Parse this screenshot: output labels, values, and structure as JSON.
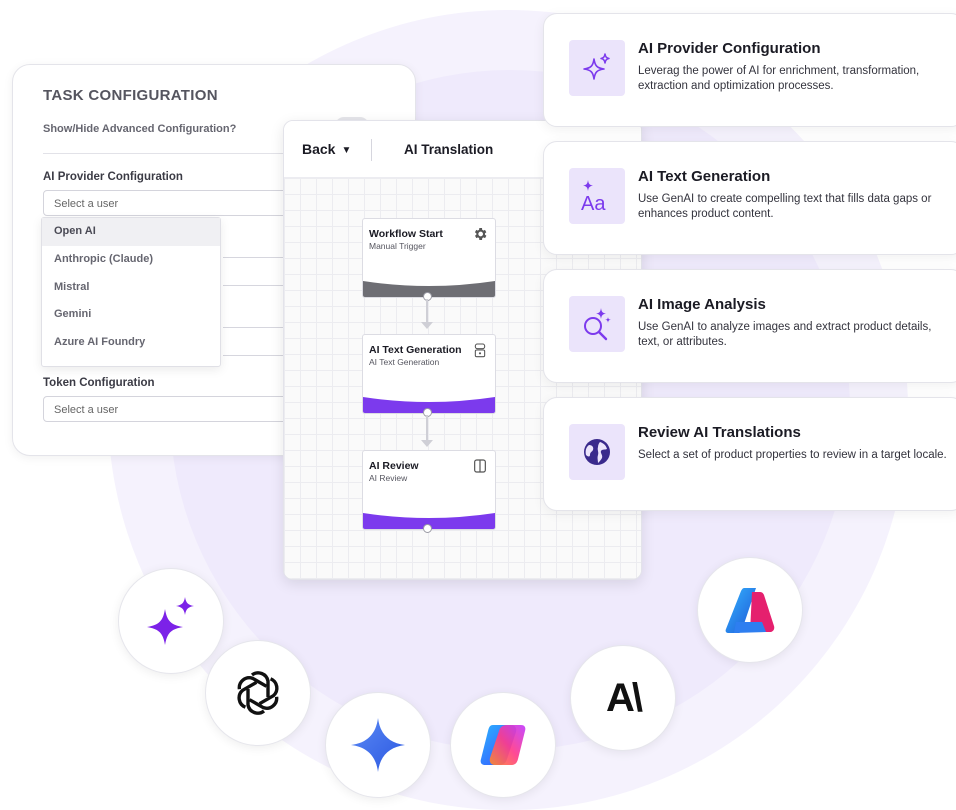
{
  "task_config": {
    "title": "TASK CONFIGURATION",
    "advanced_label": "Show/Hide Advanced Configuration?",
    "ai_provider_label": "AI Provider Configuration",
    "ai_provider_placeholder": "Select a user",
    "dropdown_options": [
      "Open AI",
      "Anthropic (Claude)",
      "Mistral",
      "Gemini",
      "Azure AI Foundry"
    ],
    "token_label": "Token Configuration",
    "token_placeholder": "Select a user"
  },
  "workflow": {
    "back_label": "Back",
    "title": "AI Translation",
    "nodes": [
      {
        "title": "Workflow Start",
        "subtitle": "Manual Trigger",
        "icon": "gear-icon",
        "color": "#6e6e74"
      },
      {
        "title": "AI Text Generation",
        "subtitle": "AI Text Generation",
        "icon": "robot-icon",
        "color": "#7c3aed"
      },
      {
        "title": "AI Review",
        "subtitle": "AI Review",
        "icon": "book-icon",
        "color": "#7c3aed"
      }
    ]
  },
  "features": [
    {
      "title": "AI Provider Configuration",
      "description": "Leverag  the power of AI for enrichment, transformation, extraction and optimization processes.",
      "icon": "sparkle-icon"
    },
    {
      "title": "AI Text Generation",
      "description": "Use GenAI to create compelling text that fills data gaps or enhances product content.",
      "icon": "text-sparkle-icon"
    },
    {
      "title": "AI Image Analysis",
      "description": "Use GenAI to analyze images and extract product details, text, or attributes.",
      "icon": "image-search-icon"
    },
    {
      "title": "Review AI Translations",
      "description": "Select a set of product properties to review in a target locale.",
      "icon": "globe-icon"
    }
  ],
  "logos": [
    {
      "name": "sparkle-logo-icon"
    },
    {
      "name": "openai-logo-icon"
    },
    {
      "name": "gemini-logo-icon"
    },
    {
      "name": "copilot-logo-icon"
    },
    {
      "name": "anthropic-logo-icon",
      "text": "A\\"
    },
    {
      "name": "azure-logo-icon"
    }
  ],
  "colors": {
    "accent": "#7c3aed",
    "icon_bg": "#ebe4fb",
    "gray_band": "#6e6e74"
  }
}
